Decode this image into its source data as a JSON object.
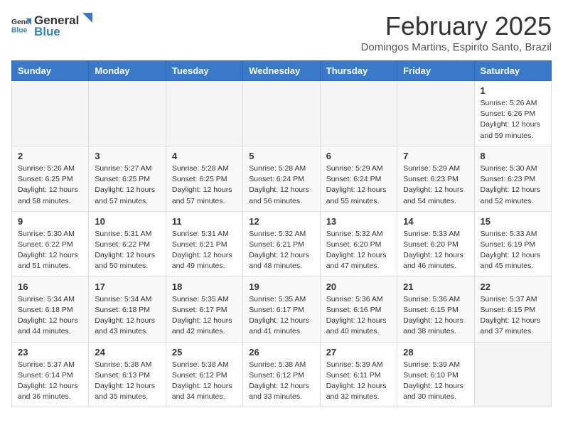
{
  "logo": {
    "general": "General",
    "blue": "Blue"
  },
  "title": "February 2025",
  "subtitle": "Domingos Martins, Espirito Santo, Brazil",
  "days_of_week": [
    "Sunday",
    "Monday",
    "Tuesday",
    "Wednesday",
    "Thursday",
    "Friday",
    "Saturday"
  ],
  "weeks": [
    [
      {
        "day": "",
        "info": ""
      },
      {
        "day": "",
        "info": ""
      },
      {
        "day": "",
        "info": ""
      },
      {
        "day": "",
        "info": ""
      },
      {
        "day": "",
        "info": ""
      },
      {
        "day": "",
        "info": ""
      },
      {
        "day": "1",
        "info": "Sunrise: 5:26 AM\nSunset: 6:26 PM\nDaylight: 12 hours and 59 minutes."
      }
    ],
    [
      {
        "day": "2",
        "info": "Sunrise: 5:26 AM\nSunset: 6:25 PM\nDaylight: 12 hours and 58 minutes."
      },
      {
        "day": "3",
        "info": "Sunrise: 5:27 AM\nSunset: 6:25 PM\nDaylight: 12 hours and 57 minutes."
      },
      {
        "day": "4",
        "info": "Sunrise: 5:28 AM\nSunset: 6:25 PM\nDaylight: 12 hours and 57 minutes."
      },
      {
        "day": "5",
        "info": "Sunrise: 5:28 AM\nSunset: 6:24 PM\nDaylight: 12 hours and 56 minutes."
      },
      {
        "day": "6",
        "info": "Sunrise: 5:29 AM\nSunset: 6:24 PM\nDaylight: 12 hours and 55 minutes."
      },
      {
        "day": "7",
        "info": "Sunrise: 5:29 AM\nSunset: 6:23 PM\nDaylight: 12 hours and 54 minutes."
      },
      {
        "day": "8",
        "info": "Sunrise: 5:30 AM\nSunset: 6:23 PM\nDaylight: 12 hours and 52 minutes."
      }
    ],
    [
      {
        "day": "9",
        "info": "Sunrise: 5:30 AM\nSunset: 6:22 PM\nDaylight: 12 hours and 51 minutes."
      },
      {
        "day": "10",
        "info": "Sunrise: 5:31 AM\nSunset: 6:22 PM\nDaylight: 12 hours and 50 minutes."
      },
      {
        "day": "11",
        "info": "Sunrise: 5:31 AM\nSunset: 6:21 PM\nDaylight: 12 hours and 49 minutes."
      },
      {
        "day": "12",
        "info": "Sunrise: 5:32 AM\nSunset: 6:21 PM\nDaylight: 12 hours and 48 minutes."
      },
      {
        "day": "13",
        "info": "Sunrise: 5:32 AM\nSunset: 6:20 PM\nDaylight: 12 hours and 47 minutes."
      },
      {
        "day": "14",
        "info": "Sunrise: 5:33 AM\nSunset: 6:20 PM\nDaylight: 12 hours and 46 minutes."
      },
      {
        "day": "15",
        "info": "Sunrise: 5:33 AM\nSunset: 6:19 PM\nDaylight: 12 hours and 45 minutes."
      }
    ],
    [
      {
        "day": "16",
        "info": "Sunrise: 5:34 AM\nSunset: 6:18 PM\nDaylight: 12 hours and 44 minutes."
      },
      {
        "day": "17",
        "info": "Sunrise: 5:34 AM\nSunset: 6:18 PM\nDaylight: 12 hours and 43 minutes."
      },
      {
        "day": "18",
        "info": "Sunrise: 5:35 AM\nSunset: 6:17 PM\nDaylight: 12 hours and 42 minutes."
      },
      {
        "day": "19",
        "info": "Sunrise: 5:35 AM\nSunset: 6:17 PM\nDaylight: 12 hours and 41 minutes."
      },
      {
        "day": "20",
        "info": "Sunrise: 5:36 AM\nSunset: 6:16 PM\nDaylight: 12 hours and 40 minutes."
      },
      {
        "day": "21",
        "info": "Sunrise: 5:36 AM\nSunset: 6:15 PM\nDaylight: 12 hours and 38 minutes."
      },
      {
        "day": "22",
        "info": "Sunrise: 5:37 AM\nSunset: 6:15 PM\nDaylight: 12 hours and 37 minutes."
      }
    ],
    [
      {
        "day": "23",
        "info": "Sunrise: 5:37 AM\nSunset: 6:14 PM\nDaylight: 12 hours and 36 minutes."
      },
      {
        "day": "24",
        "info": "Sunrise: 5:38 AM\nSunset: 6:13 PM\nDaylight: 12 hours and 35 minutes."
      },
      {
        "day": "25",
        "info": "Sunrise: 5:38 AM\nSunset: 6:12 PM\nDaylight: 12 hours and 34 minutes."
      },
      {
        "day": "26",
        "info": "Sunrise: 5:38 AM\nSunset: 6:12 PM\nDaylight: 12 hours and 33 minutes."
      },
      {
        "day": "27",
        "info": "Sunrise: 5:39 AM\nSunset: 6:11 PM\nDaylight: 12 hours and 32 minutes."
      },
      {
        "day": "28",
        "info": "Sunrise: 5:39 AM\nSunset: 6:10 PM\nDaylight: 12 hours and 30 minutes."
      },
      {
        "day": "",
        "info": ""
      }
    ]
  ]
}
